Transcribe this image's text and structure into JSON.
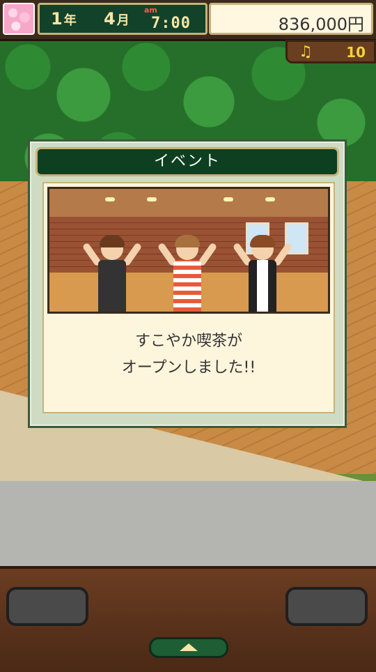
{
  "hud": {
    "year_num": "1",
    "year_unit": "年",
    "month_num": "4",
    "month_unit": "月",
    "ampm": "am",
    "time": "7:00",
    "money": "836,000円",
    "music_value": "10"
  },
  "dialog": {
    "title": "イベント",
    "message_line1": "すこやか喫茶が",
    "message_line2": "オープンしました!!"
  },
  "icons": {
    "season": "cherry-blossom-icon",
    "music": "music-note-icon",
    "menu": "up-arrow-icon"
  },
  "colors": {
    "dialog_title_bg": "#0d3f20",
    "gold_border": "#c7b279",
    "money_bg": "#fff7e0"
  }
}
